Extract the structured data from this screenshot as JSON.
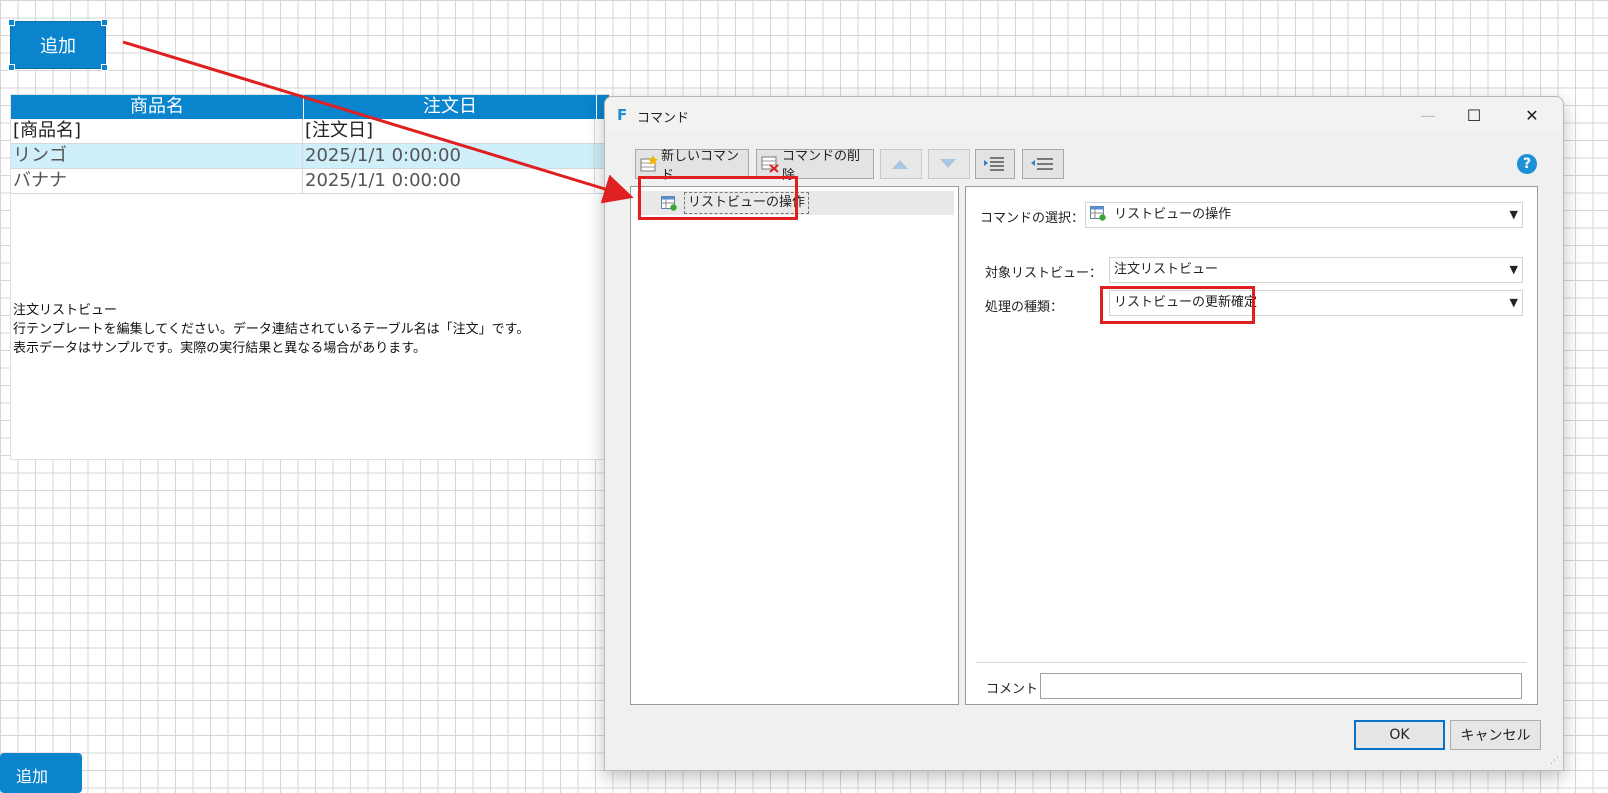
{
  "canvas": {
    "add_button_label": "追加",
    "add_button_bottom_label": "追加",
    "listview": {
      "columns": [
        "商品名",
        "注文日"
      ],
      "template_row": [
        "[商品名]",
        "[注文日]"
      ],
      "rows": [
        [
          "リンゴ",
          "2025/1/1 0:00:00"
        ],
        [
          "バナナ",
          "2025/1/1 0:00:00"
        ]
      ],
      "note_lines": [
        "注文リストビュー",
        "行テンプレートを編集してください。データ連結されているテーブル名は「注文」です。",
        "表示データはサンプルです。実際の実行結果と異なる場合があります。"
      ]
    }
  },
  "dialog": {
    "app_icon": "F",
    "title": "コマンド",
    "window_buttons": {
      "minimize": "—",
      "maximize": "☐",
      "close": "✕"
    },
    "toolbar": {
      "new_command": "新しいコマンド",
      "delete_command": "コマンドの削除"
    },
    "help_label": "?",
    "tree": {
      "item_label": "リストビューの操作"
    },
    "form": {
      "command_select_label": "コマンドの選択：",
      "command_select_value": "リストビューの操作",
      "target_listview_label": "対象リストビュー：",
      "target_listview_value": "注文リストビュー",
      "operation_type_label": "処理の種類：",
      "operation_type_value": "リストビューの更新確定",
      "comment_label": "コメント",
      "comment_value": ""
    },
    "buttons": {
      "ok": "OK",
      "cancel": "キャンセル"
    }
  },
  "colors": {
    "accent": "#0a84cc",
    "annotation": "#e02020",
    "row_highlight": "#cfeffb"
  }
}
